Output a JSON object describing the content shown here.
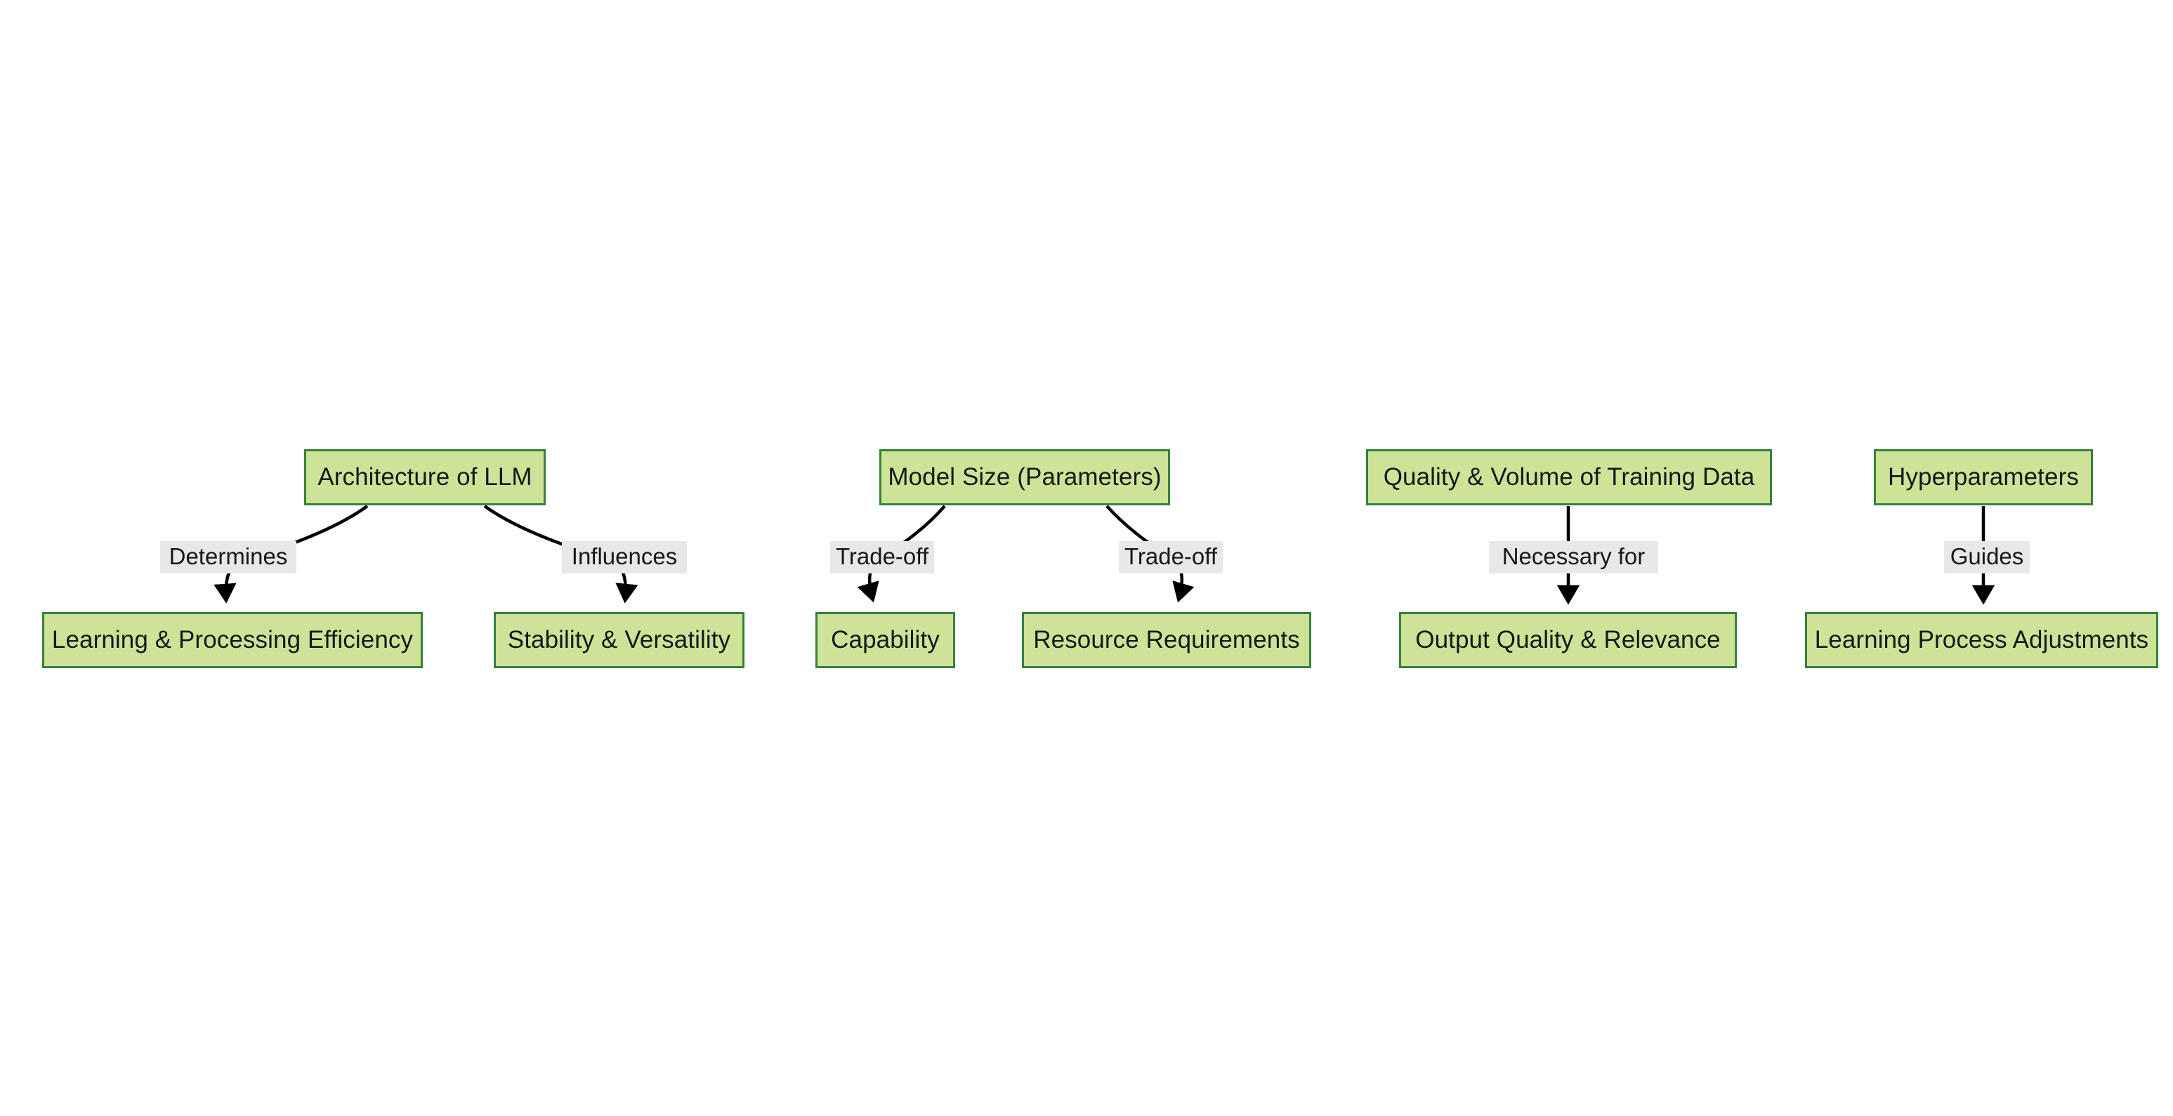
{
  "diagram": {
    "type": "flowchart",
    "orientation": "top-down",
    "background_color": "#ffffff",
    "node_fill_color": "#cde498",
    "node_border_color": "#36813a",
    "edge_label_background_color": "#e8e8e8",
    "edge_color": "#000000",
    "text_color": "#181818",
    "groups": [
      {
        "id": "architecture-group",
        "root": {
          "id": "architecture-of-llm",
          "label": "Architecture of LLM"
        },
        "children": [
          {
            "id": "learning-processing-efficiency",
            "label": "Learning & Processing Efficiency",
            "edge_label": "Determines"
          },
          {
            "id": "stability-versatility",
            "label": "Stability & Versatility",
            "edge_label": "Influences"
          }
        ]
      },
      {
        "id": "model-size-group",
        "root": {
          "id": "model-size-parameters",
          "label": "Model Size (Parameters)"
        },
        "children": [
          {
            "id": "capability",
            "label": "Capability",
            "edge_label": "Trade-off"
          },
          {
            "id": "resource-requirements",
            "label": "Resource Requirements",
            "edge_label": "Trade-off"
          }
        ]
      },
      {
        "id": "training-data-group",
        "root": {
          "id": "quality-volume-training-data",
          "label": "Quality & Volume of Training Data"
        },
        "children": [
          {
            "id": "output-quality-relevance",
            "label": "Output Quality & Relevance",
            "edge_label": "Necessary for"
          }
        ]
      },
      {
        "id": "hyperparameters-group",
        "root": {
          "id": "hyperparameters",
          "label": "Hyperparameters"
        },
        "children": [
          {
            "id": "learning-process-adjustments",
            "label": "Learning Process Adjustments",
            "edge_label": "Guides"
          }
        ]
      }
    ],
    "nodes": {
      "architecture_of_llm": "Architecture of LLM",
      "learning_processing_efficiency": "Learning & Processing Efficiency",
      "stability_versatility": "Stability & Versatility",
      "model_size_parameters": "Model Size (Parameters)",
      "capability": "Capability",
      "resource_requirements": "Resource Requirements",
      "quality_volume_training_data": "Quality & Volume of Training Data",
      "output_quality_relevance": "Output Quality & Relevance",
      "hyperparameters": "Hyperparameters",
      "learning_process_adjustments": "Learning Process Adjustments"
    },
    "edge_labels": {
      "determines": "Determines",
      "influences": "Influences",
      "trade_off_capability": "Trade-off",
      "trade_off_resources": "Trade-off",
      "necessary_for": "Necessary for",
      "guides": "Guides"
    }
  }
}
